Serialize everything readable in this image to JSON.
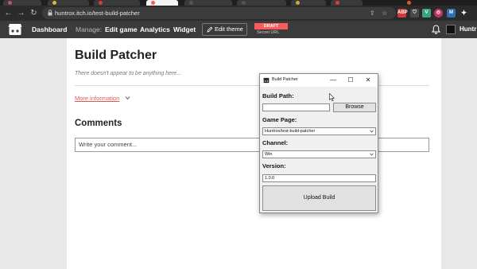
{
  "browser": {
    "url": "huntrox.itch.io/test-build-patcher",
    "nav": {
      "back": "←",
      "forward": "→",
      "reload": "↻"
    },
    "omnibox_icons": [
      "share-icon",
      "star-icon"
    ],
    "extensions": [
      {
        "name": "abp-extension-icon",
        "label": "ABP",
        "color": "#d33a3a"
      },
      {
        "name": "shield-extension-icon",
        "label": "",
        "color": "#4a4a4a"
      },
      {
        "name": "vue-devtools-icon",
        "label": "V",
        "color": "#3aa57a"
      },
      {
        "name": "circle-extension-icon",
        "label": "◎",
        "color": "#c0336a"
      },
      {
        "name": "m-extension-icon",
        "label": "M",
        "color": "#2f6fb3"
      },
      {
        "name": "puzzle-extensions-icon",
        "label": "✦",
        "color": "#2b2b2b"
      }
    ]
  },
  "itchbar": {
    "dashboard": "Dashboard",
    "manage_label": "Manage:",
    "edit_game": "Edit game",
    "analytics": "Analytics",
    "widget": "Widget",
    "edit_theme": "Edit theme",
    "draft": "DRAFT",
    "secret_url": "Secret URL",
    "username": "Huntr"
  },
  "page": {
    "title": "Build Patcher",
    "empty_note": "There doesn't appear to be anything here...",
    "more_info": "More information",
    "comments_title": "Comments",
    "comment_placeholder": "Write your comment..."
  },
  "dialog": {
    "title": "Build Patcher",
    "controls": {
      "minimize": "—",
      "maximize": "☐",
      "close": "✕"
    },
    "build_path_label": "Build Path:",
    "build_path_value": "",
    "browse_label": "Browse",
    "game_page_label": "Game Page:",
    "game_page_value": "Huntrox/test-build-patcher",
    "channel_label": "Channel:",
    "channel_value": "Win",
    "version_label": "Version:",
    "version_value": "1.0.0",
    "upload_label": "Upload Build"
  },
  "colors": {
    "itch_accent": "#fa5c5c",
    "itchbar_bg": "#3b3b3b",
    "browser_bg": "#2b2b2b"
  }
}
